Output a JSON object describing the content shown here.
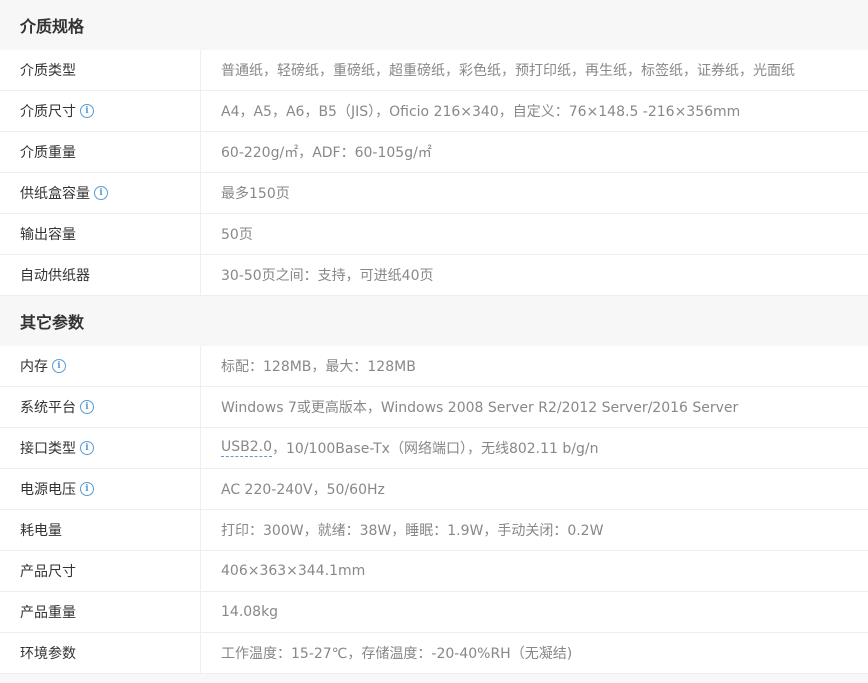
{
  "sections": [
    {
      "title": "介质规格",
      "rows": [
        {
          "label": "介质类型",
          "value": "普通纸，轻磅纸，重磅纸，超重磅纸，彩色纸，预打印纸，再生纸，标签纸，证券纸，光面纸",
          "info": false
        },
        {
          "label": "介质尺寸",
          "value": "A4，A5，A6，B5（JIS），Oficio 216×340，自定义：76×148.5 -216×356mm",
          "info": true
        },
        {
          "label": "介质重量",
          "value": "60-220g/㎡，ADF：60-105g/㎡",
          "info": false
        },
        {
          "label": "供纸盒容量",
          "value": "最多150页",
          "info": true
        },
        {
          "label": "输出容量",
          "value": "50页",
          "info": false
        },
        {
          "label": "自动供纸器",
          "value": "30-50页之间：支持，可进纸40页",
          "info": false
        }
      ]
    },
    {
      "title": "其它参数",
      "rows": [
        {
          "label": "内存",
          "value": "标配：128MB，最大：128MB",
          "info": true
        },
        {
          "label": "系统平台",
          "value": "Windows 7或更高版本，Windows 2008 Server R2/2012 Server/2016 Server",
          "info": true
        },
        {
          "label": "接口类型",
          "value_link": "USB2.0",
          "value": "，10/100Base-Tx（网络端口），无线802.11 b/g/n",
          "info": true
        },
        {
          "label": "电源电压",
          "value": "AC 220-240V，50/60Hz",
          "info": true
        },
        {
          "label": "耗电量",
          "value": "打印：300W，就绪：38W，睡眠：1.9W，手动关闭：0.2W",
          "info": false
        },
        {
          "label": "产品尺寸",
          "value": "406×363×344.1mm",
          "info": false
        },
        {
          "label": "产品重量",
          "value": "14.08kg",
          "info": false
        },
        {
          "label": "环境参数",
          "value": "工作温度：15-27℃，存储温度：-20-40%RH（无凝结)",
          "info": false
        }
      ]
    }
  ],
  "info_glyph": "i",
  "colors": {
    "label": "#333333",
    "value": "#888888",
    "info": "#5b9bd5",
    "header_bg": "#f7f7f7",
    "row_bg": "#ffffff"
  }
}
